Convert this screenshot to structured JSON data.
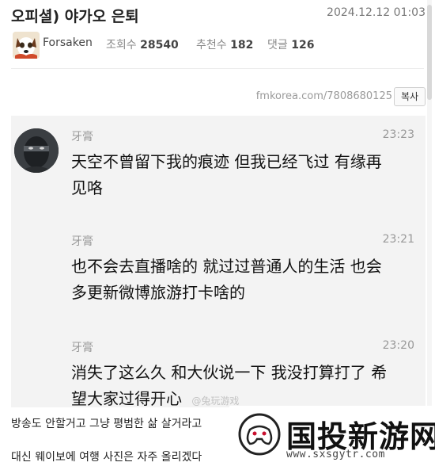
{
  "post": {
    "title": "오피셜) 야가오 은퇴",
    "date": "2024.12.12 01:03",
    "author": "Forsaken",
    "views_label": "조회수",
    "views": "28540",
    "likes_label": "추천수",
    "likes": "182",
    "comments_label": "댓글",
    "comments": "126",
    "url": "fmkorea.com/7808680125",
    "copy_label": "복사"
  },
  "screenshot": {
    "comments": [
      {
        "name": "牙膏",
        "time": "23:23",
        "lines": [
          "天空不曾留下我的痕迹 但我已经飞过 有缘再",
          "见咯"
        ]
      },
      {
        "name": "牙膏",
        "time": "23:21",
        "lines": [
          "也不会去直播啥的 就过过普通人的生活 也会",
          "多更新微博旅游打卡啥的"
        ]
      },
      {
        "name": "牙膏",
        "time": "23:20",
        "lines": [
          "消失了这么久 和大伙说一下 我没打算打了 希",
          "望大家过得开心"
        ]
      }
    ],
    "watermark": "@兔玩游戏"
  },
  "body": {
    "line1": "방송도 안할거고 그냥 평범한 삶 살거라고",
    "line2": "대신 웨이보에 여행 사진은 자주 올리겠다"
  },
  "logo": {
    "name": "国投新游网",
    "url": "www.sxsgytr.com"
  },
  "colors": {
    "background": "#ffffff",
    "screenshot_bg": "#f3f3f3",
    "muted": "#999999"
  }
}
